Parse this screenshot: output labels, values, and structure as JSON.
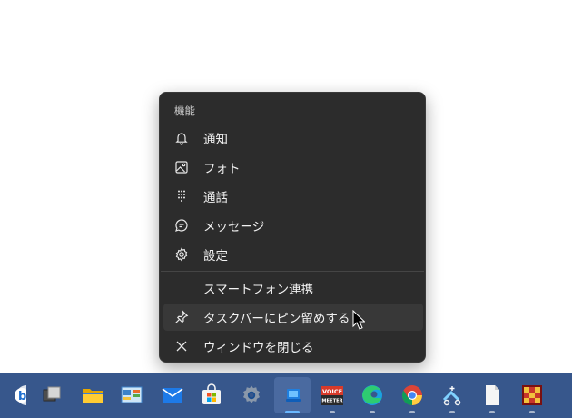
{
  "menu": {
    "header": "機能",
    "items": [
      {
        "label": "通知",
        "icon": "bell-icon"
      },
      {
        "label": "フォト",
        "icon": "photo-icon"
      },
      {
        "label": "通話",
        "icon": "dialpad-icon"
      },
      {
        "label": "メッセージ",
        "icon": "message-icon"
      },
      {
        "label": "設定",
        "icon": "gear-icon"
      }
    ],
    "app_name": "スマートフォン連携",
    "pin": {
      "label": "タスクバーにピン留めする",
      "icon": "pin-icon"
    },
    "close": {
      "label": "ウィンドウを閉じる",
      "icon": "close-icon"
    }
  },
  "taskbar": {
    "voicemeeter_top": "VOICE",
    "voicemeeter_bottom": "MEETER",
    "icons": [
      "bing-icon",
      "desktop-switcher-icon",
      "file-explorer-icon",
      "control-panel-icon",
      "mail-icon",
      "microsoft-store-icon",
      "settings-icon",
      "phone-link-icon",
      "voicemeeter-icon",
      "edge-icon",
      "chrome-icon",
      "snipping-tool-icon",
      "notepad-icon",
      "game-icon"
    ]
  }
}
